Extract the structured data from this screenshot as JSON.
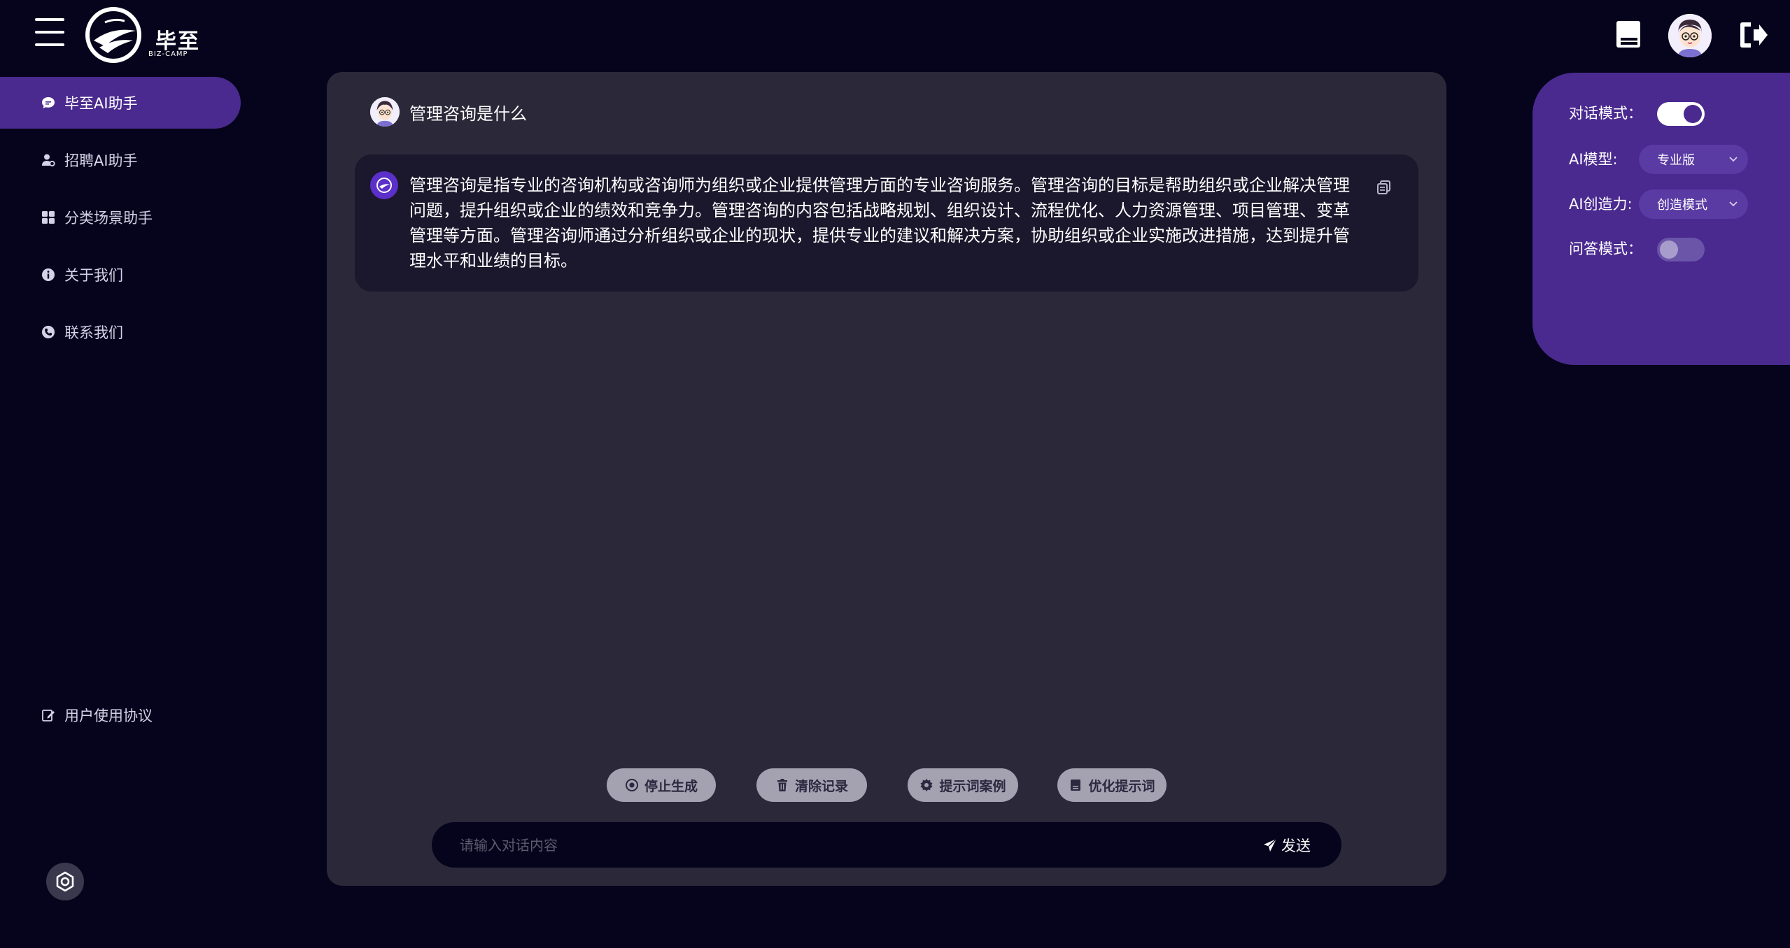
{
  "brand": {
    "name_cn": "毕至",
    "name_en": "BIZ-CAMP"
  },
  "sidebar": {
    "items": [
      {
        "label": "毕至AI助手",
        "icon": "chat-bubble-icon",
        "active": true
      },
      {
        "label": "招聘AI助手",
        "icon": "user-gear-icon",
        "active": false
      },
      {
        "label": "分类场景助手",
        "icon": "grid-icon",
        "active": false
      },
      {
        "label": "关于我们",
        "icon": "info-icon",
        "active": false
      },
      {
        "label": "联系我们",
        "icon": "phone-icon",
        "active": false
      }
    ],
    "agreement": {
      "label": "用户使用协议",
      "icon": "edit-document-icon"
    }
  },
  "chat": {
    "user_question": "管理咨询是什么",
    "answer": "管理咨询是指专业的咨询机构或咨询师为组织或企业提供管理方面的专业咨询服务。管理咨询的目标是帮助组织或企业解决管理问题，提升组织或企业的绩效和竞争力。管理咨询的内容包括战略规划、组织设计、流程优化、人力资源管理、项目管理、变革管理等方面。管理咨询师通过分析组织或企业的现状，提供专业的建议和解决方案，协助组织或企业实施改进措施，达到提升管理水平和业绩的目标。"
  },
  "actions": {
    "stop": "停止生成",
    "clear": "清除记录",
    "examples": "提示词案例",
    "optimize": "优化提示词"
  },
  "input": {
    "placeholder": "请输入对话内容",
    "value": "",
    "send_label": "发送"
  },
  "settings": {
    "dialog_mode_label": "对话模式：",
    "dialog_mode_on": true,
    "model_label": "AI模型:",
    "model_value": "专业版",
    "creativity_label": "AI创造力:",
    "creativity_value": "创造模式",
    "qa_mode_label": "问答模式：",
    "qa_mode_on": false
  },
  "colors": {
    "background": "#06041c",
    "panel": "#2b2839",
    "accent": "#4a2a8f",
    "card": "#1b172c",
    "action_button": "#a4a2b1"
  }
}
